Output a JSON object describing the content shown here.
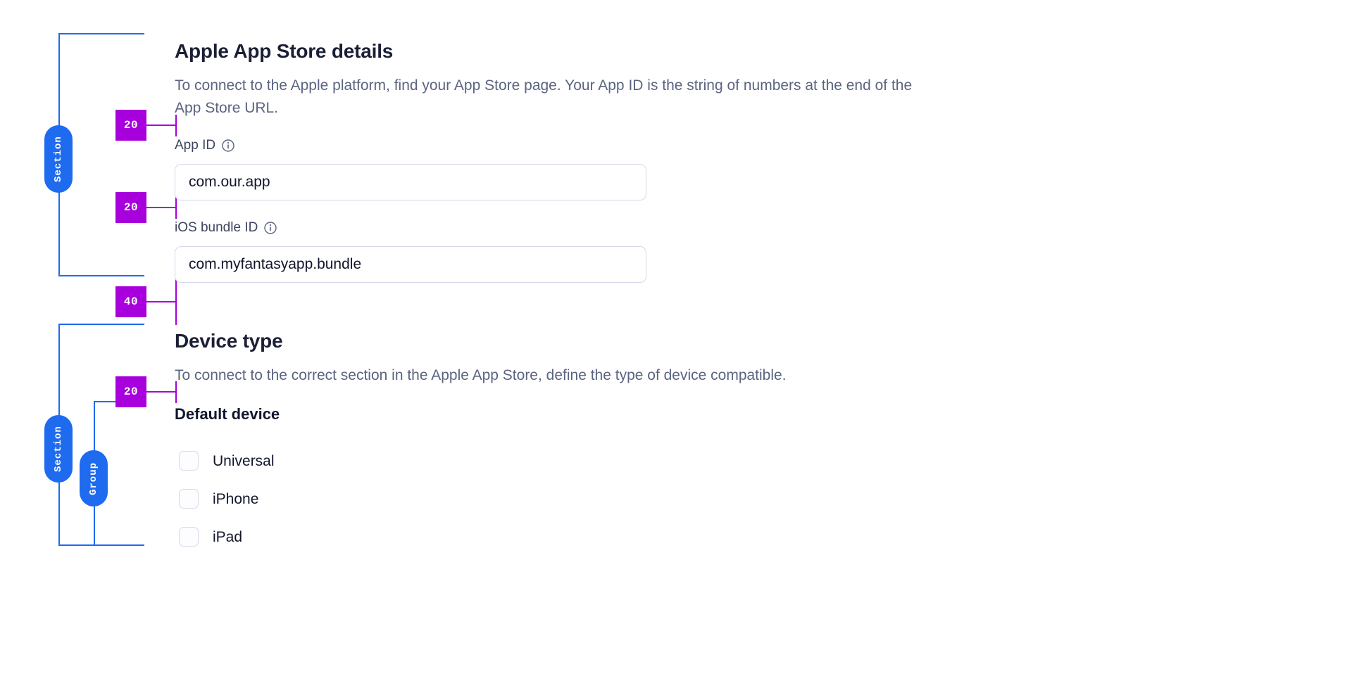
{
  "sections": [
    {
      "id": "apple-app-store-details",
      "title": "Apple App Store details",
      "description": "To connect to the Apple platform, find your App Store page. Your App ID is the string of numbers at the end of the App Store URL.",
      "fields": [
        {
          "label": "App ID",
          "value": "com.our.app",
          "placeholder": "",
          "info_icon": "info-icon"
        },
        {
          "label": "iOS bundle ID",
          "value": "com.myfantasyapp.bundle",
          "placeholder": "",
          "info_icon": "info-icon"
        }
      ]
    },
    {
      "id": "device-type",
      "title": "Device type",
      "description": "To connect to the correct section in the Apple App Store, define the type of device compatible.",
      "group": {
        "title": "Default device",
        "options": [
          {
            "label": "Universal",
            "checked": false
          },
          {
            "label": "iPhone",
            "checked": false
          },
          {
            "label": "iPad",
            "checked": false
          }
        ]
      }
    }
  ],
  "annotations": {
    "structure_labels": [
      {
        "name": "section-label-1",
        "text": "Section"
      },
      {
        "name": "section-label-2",
        "text": "Section"
      },
      {
        "name": "group-label-1",
        "text": "Group"
      }
    ],
    "spacing": [
      {
        "name": "spacing-title-to-app-id",
        "value": "20"
      },
      {
        "name": "spacing-app-id-to-bundle-id",
        "value": "20"
      },
      {
        "name": "spacing-section-to-section",
        "value": "40"
      },
      {
        "name": "spacing-desc-to-default-device",
        "value": "20"
      }
    ]
  },
  "colors": {
    "structure_blue": "#1f6bf0",
    "spacing_magenta": "#a800dd",
    "heading_text": "#11162b",
    "body_text": "#5b6480",
    "input_border": "#d5d8e8"
  }
}
